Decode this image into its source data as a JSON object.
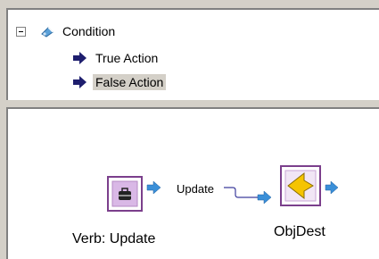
{
  "tree": {
    "root": {
      "label": "Condition",
      "icon": "condition-icon",
      "expander": "collapse-toggle"
    },
    "children": [
      {
        "label": "True Action",
        "icon": "action-arrow-icon",
        "selected": false
      },
      {
        "label": "False Action",
        "icon": "action-arrow-icon",
        "selected": true
      }
    ]
  },
  "diagram": {
    "nodes": [
      {
        "label": "Verb: Update",
        "icon": "verb-briefcase-icon"
      },
      {
        "label": "ObjDest",
        "icon": "destination-arrow-icon"
      }
    ],
    "edge": {
      "label": "Update"
    }
  },
  "colors": {
    "node_border": "#7b3f8c",
    "node_fill": "#d9b8e6",
    "port_arrow": "#3a8fd8",
    "edge_line": "#3c3c9c",
    "tree_arrow": "#202070",
    "dest_arrow": "#f5c400"
  }
}
